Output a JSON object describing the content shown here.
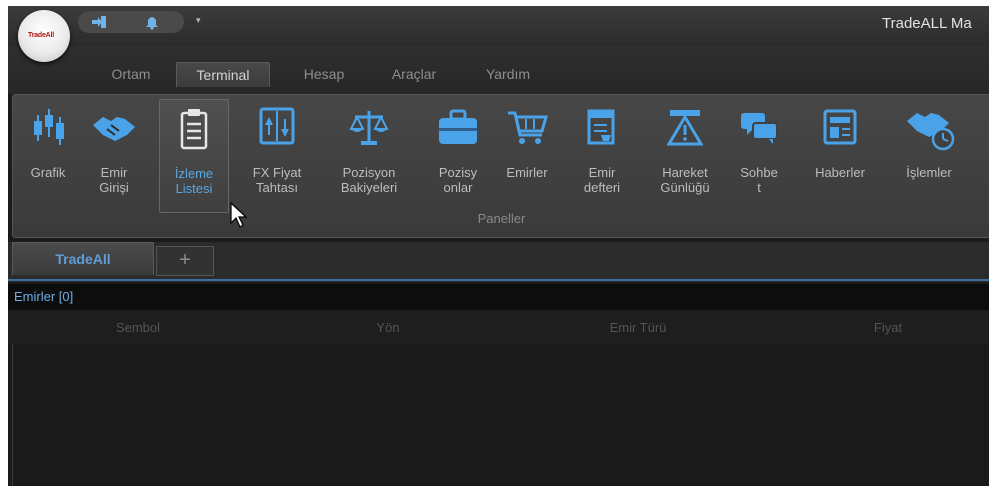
{
  "app": {
    "title": "TradeALL Ma",
    "logo_text": "TradeAll"
  },
  "quick_access": [
    "login-icon",
    "bell-icon"
  ],
  "menu": {
    "tabs": [
      {
        "label": "Ortam",
        "active": false
      },
      {
        "label": "Terminal",
        "active": true
      },
      {
        "label": "Hesap",
        "active": false
      },
      {
        "label": "Araçlar",
        "active": false
      },
      {
        "label": "Yardım",
        "active": false
      }
    ]
  },
  "ribbon": {
    "group_name": "Paneller",
    "buttons": [
      {
        "label": "Grafik",
        "icon": "candlestick-chart-icon"
      },
      {
        "label": "Emir\nGirişi",
        "icon": "handshake-icon"
      },
      {
        "label": "İzleme\nListesi",
        "icon": "clipboard-list-icon",
        "hovered": true
      },
      {
        "label": "FX Fiyat\nTahtası",
        "icon": "price-board-icon"
      },
      {
        "label": "Pozisyon\nBakiyeleri",
        "icon": "scales-icon"
      },
      {
        "label": "Pozisy\nonlar",
        "icon": "briefcase-icon"
      },
      {
        "label": "Emirler",
        "icon": "shopping-cart-icon"
      },
      {
        "label": "Emir\ndefteri",
        "icon": "order-book-icon"
      },
      {
        "label": "Hareket\nGünlüğü",
        "icon": "warning-log-icon"
      },
      {
        "label": "Sohbe\nt",
        "icon": "chat-bubbles-icon"
      },
      {
        "label": "Haberler",
        "icon": "newspaper-icon"
      },
      {
        "label": "İşlemler",
        "icon": "handshake-clock-icon"
      }
    ]
  },
  "doc_tabs": {
    "active_label": "TradeAll",
    "add_label": "+"
  },
  "orders_panel": {
    "title": "Emirler  [0]",
    "columns": [
      "Sembol",
      "Yön",
      "Emir Türü",
      "Fiyat"
    ]
  },
  "colors": {
    "accent_blue": "#4aa3e8",
    "background": "#1b1b1b",
    "ribbon": "#404040"
  }
}
